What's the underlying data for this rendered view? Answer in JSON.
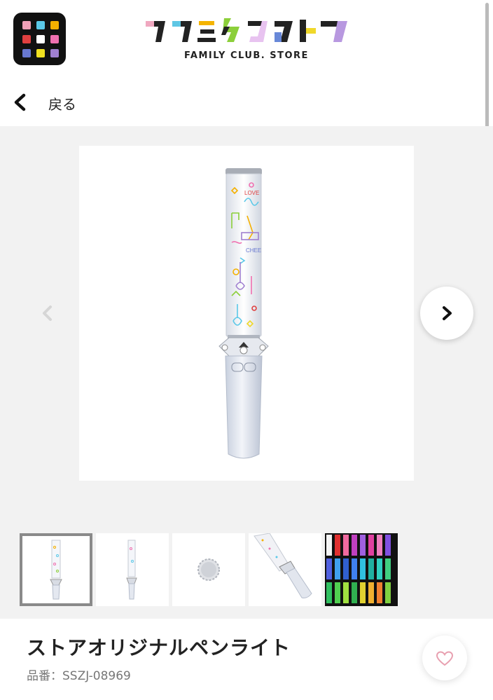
{
  "header": {
    "logo_text": "ファミクラストア",
    "logo_subtitle": "FAMILY CLUB. STORE",
    "app_grid_colors": [
      "#f0a0b8",
      "#5ac8e8",
      "#f4b000",
      "#e04040",
      "#ffffff",
      "#f070b0",
      "#6878d0",
      "#f0e020",
      "#a080d0"
    ],
    "logo_colors": [
      "#f0a8c0",
      "#5ec6e4",
      "#f4b400",
      "#8ccf3a",
      "#e8c3f0",
      "#6888d8",
      "#f0d82a",
      "#b898e0"
    ]
  },
  "nav": {
    "back_icon": "chevron-left-icon",
    "back_label": "戻る"
  },
  "gallery": {
    "prev_icon": "chevron-left-icon",
    "next_icon": "chevron-right-icon",
    "main_image": "penlight-product-image",
    "penlight_labels": [
      "LOVE",
      "CHEE"
    ],
    "thumbnails": [
      {
        "name": "penlight-front",
        "selected": true
      },
      {
        "name": "penlight-side",
        "selected": false
      },
      {
        "name": "penlight-cap",
        "selected": false
      },
      {
        "name": "penlight-angle",
        "selected": false
      },
      {
        "name": "penlight-colors",
        "selected": false
      }
    ]
  },
  "product": {
    "title": "ストアオリジナルペンライト",
    "code": "品番：SSZJ-08969",
    "favorite_icon": "heart-outline-icon"
  },
  "colors": {
    "accent_heart": "#e8a0b0",
    "gallery_bg": "#f2f2f2"
  }
}
